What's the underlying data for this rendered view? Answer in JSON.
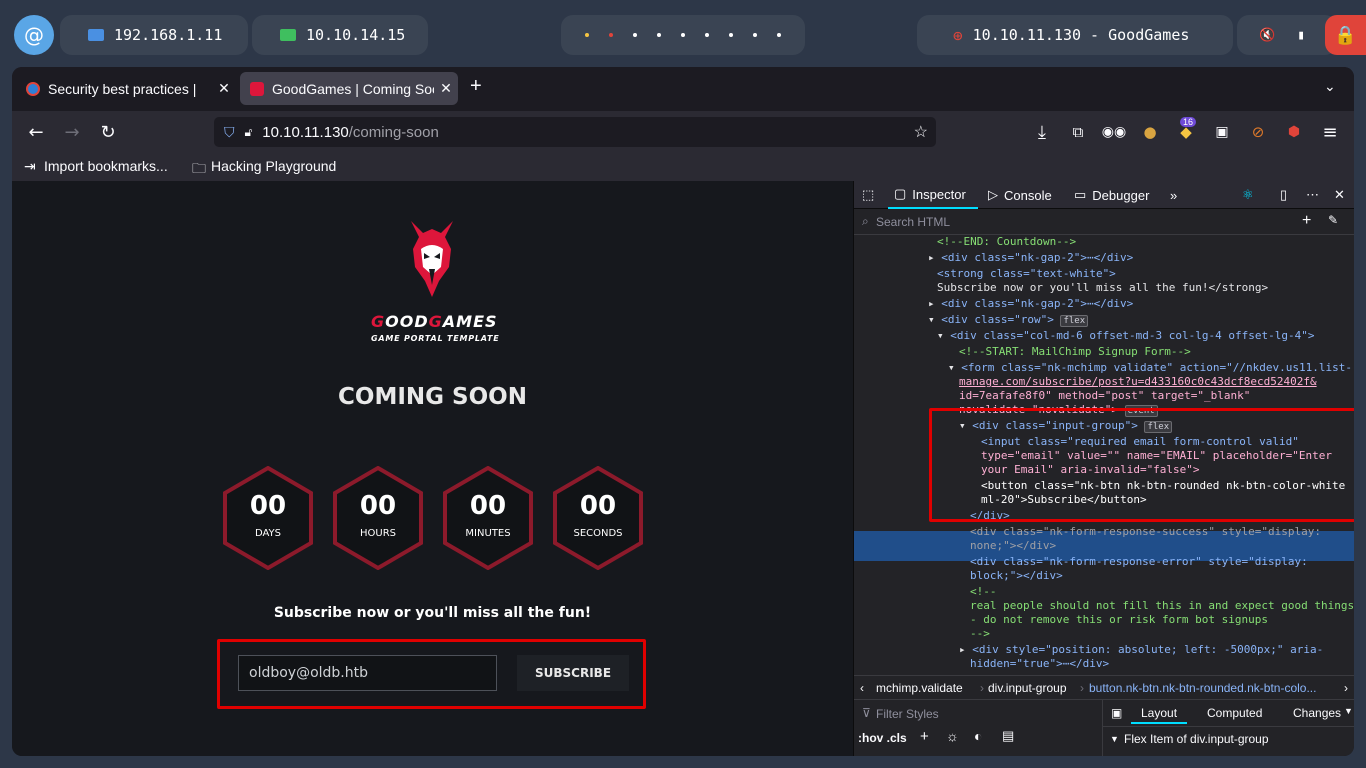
{
  "panel": {
    "ip1": "192.168.1.11",
    "ip2": "10.10.14.15",
    "target": "10.10.11.130 - GoodGames"
  },
  "browser": {
    "tabs": [
      {
        "label": "Security best practices |",
        "active": false
      },
      {
        "label": "GoodGames | Coming Soon",
        "active": true
      }
    ],
    "url_host": "10.10.11.130",
    "url_path": "/coming-soon",
    "bookmarks": [
      "Import bookmarks...",
      "Hacking Playground"
    ],
    "ext_badge": "16"
  },
  "site": {
    "brand_first": "G",
    "brand_mid": "OOD",
    "brand_g2": "G",
    "brand_last": "AMES",
    "tagline": "GAME PORTAL TEMPLATE",
    "heading": "COMING SOON",
    "countdown": [
      {
        "num": "00",
        "label": "DAYS"
      },
      {
        "num": "00",
        "label": "HOURS"
      },
      {
        "num": "00",
        "label": "MINUTES"
      },
      {
        "num": "00",
        "label": "SECONDS"
      }
    ],
    "subscribe_text": "Subscribe now or you'll miss all the fun!",
    "email_value": "oldboy@oldb.htb",
    "subscribe_button": "SUBSCRIBE"
  },
  "devtools": {
    "tabs": [
      "Inspector",
      "Console",
      "Debugger"
    ],
    "search_placeholder": "Search HTML",
    "breadcrumb": [
      "mchimp.validate",
      "div.input-group",
      "button.nk-btn.nk-btn-rounded.nk-btn-colo..."
    ],
    "filter_placeholder": "Filter Styles",
    "hov_cls": ":hov .cls",
    "panel_tabs": [
      "Layout",
      "Computed",
      "Changes"
    ],
    "flex_item": "Flex Item of div.input-group",
    "code_lines": [
      "<!--END: Countdown-->",
      "<div class=\"nk-gap-2\">⋯</div>",
      "<strong class=\"text-white\">",
      "Subscribe now or you'll miss all the fun!</strong>",
      "<div class=\"nk-gap-2\">⋯</div>",
      "<div class=\"row\">",
      "<div class=\"col-md-6 offset-md-3 col-lg-4 offset-lg-4\">",
      "<!--START: MailChimp Signup Form-->",
      "<form class=\"nk-mchimp validate\" action=\"//nkdev.us11.list-",
      "manage.com/subscribe/post?u=d433160c0c43dcf8ecd52402f&",
      "id=7eafafe8f0\" method=\"post\" target=\"_blank\"",
      "novalidate=\"novalidate\">",
      "<div class=\"input-group\">",
      "<input class=\"required email form-control valid\"",
      "type=\"email\" value=\"\" name=\"EMAIL\" placeholder=\"Enter",
      "your Email\" aria-invalid=\"false\">",
      "<button class=\"nk-btn nk-btn-rounded nk-btn-color-white",
      "ml-20\">Subscribe</button>",
      "</div>",
      "<div class=\"nk-form-response-success\" style=\"display:",
      "none;\"></div>",
      "<div class=\"nk-form-response-error\" style=\"display:",
      "block;\"></div>",
      "<!--",
      "real people should not fill this in and expect good things",
      "- do not remove this or risk form bot signups",
      "-->",
      "<div style=\"position: absolute; left: -5000px;\" aria-",
      "hidden=\"true\">⋯</div>"
    ],
    "badges": {
      "flex": "flex",
      "event": "event"
    }
  },
  "colors": {
    "accent": "#dd163b",
    "highlight": "#e00000"
  }
}
